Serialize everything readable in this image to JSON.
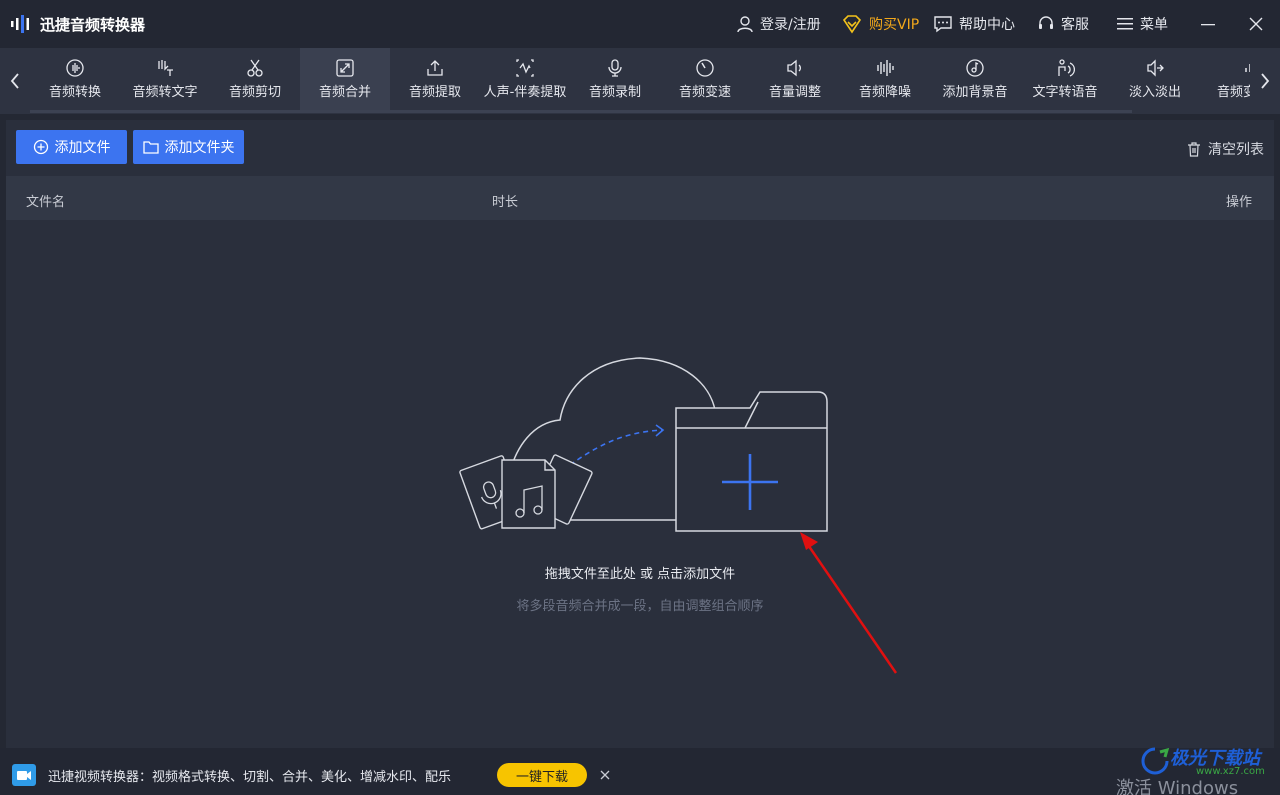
{
  "app": {
    "title": "迅捷音频转换器",
    "brand_color": "#3c74f0"
  },
  "titlebar": {
    "login": "登录/注册",
    "vip": "购买VIP",
    "help": "帮助中心",
    "service": "客服",
    "menu": "菜单"
  },
  "tools": [
    {
      "label": "音频转换",
      "icon": "waveform-circle-icon"
    },
    {
      "label": "音频转文字",
      "icon": "hand-text-icon"
    },
    {
      "label": "音频剪切",
      "icon": "scissors-icon"
    },
    {
      "label": "音频合并",
      "icon": "merge-arrows-icon",
      "active": true
    },
    {
      "label": "音频提取",
      "icon": "upload-icon"
    },
    {
      "label": "人声-伴奏提取",
      "icon": "voice-extract-icon"
    },
    {
      "label": "音频录制",
      "icon": "microphone-icon"
    },
    {
      "label": "音频变速",
      "icon": "speedometer-icon"
    },
    {
      "label": "音量调整",
      "icon": "speaker-icon"
    },
    {
      "label": "音频降噪",
      "icon": "noise-bars-icon"
    },
    {
      "label": "添加背景音",
      "icon": "music-note-circle-icon"
    },
    {
      "label": "文字转语音",
      "icon": "text-speech-icon"
    },
    {
      "label": "淡入淡出",
      "icon": "fade-icon"
    },
    {
      "label": "音频变",
      "icon": "bars-icon"
    }
  ],
  "actions": {
    "add_file": "添加文件",
    "add_folder": "添加文件夹",
    "clear_list": "清空列表"
  },
  "list": {
    "columns": [
      "文件名",
      "时长",
      "操作"
    ]
  },
  "dropzone": {
    "main_text": "拖拽文件至此处 或 点击添加文件",
    "sub_text": "将多段音频合并成一段，自由调整组合顺序"
  },
  "adbar": {
    "text": "迅捷视频转换器：视频格式转换、切割、合并、美化、增减水印、配乐",
    "button": "一键下载"
  },
  "watermark": "激活 Windows",
  "site_badge": {
    "name": "极光下载站",
    "url": "www.xz7.com"
  }
}
